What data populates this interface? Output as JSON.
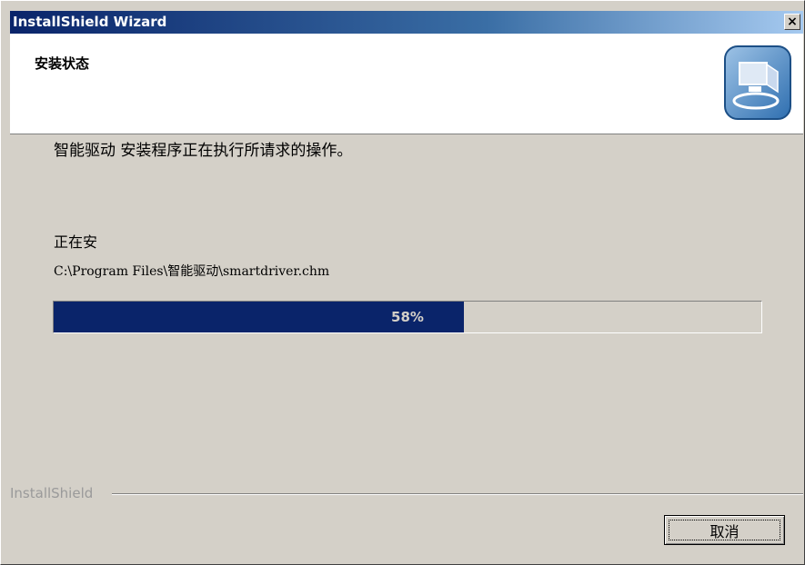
{
  "window": {
    "title": "InstallShield Wizard",
    "close_glyph": "×"
  },
  "header": {
    "title": "安装状态",
    "logo_icon": "installer-computer-icon"
  },
  "body": {
    "status_text": "智能驱动 安装程序正在执行所请求的操作。",
    "installing_label": "正在安",
    "file_path": "C:\\Program Files\\智能驱动\\smartdriver.chm"
  },
  "progress": {
    "percent": 58,
    "label": "58%"
  },
  "footer": {
    "brand": "InstallShield",
    "cancel_label": "取消"
  },
  "colors": {
    "title_bar_start": "#0a246a",
    "progress_fill": "#0a246a",
    "dialog_bg": "#d4d0c8"
  }
}
